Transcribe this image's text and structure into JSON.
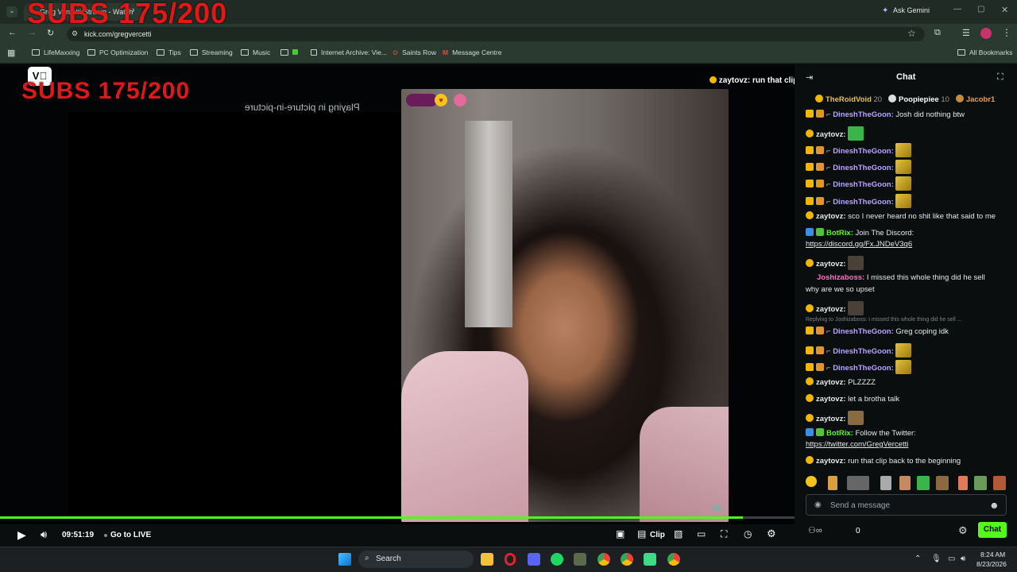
{
  "browser": {
    "tab_title": "Greg Vercetti Stream - Watch",
    "ask_gemini": "Ask Gemini",
    "url": "kick.com/gregvercetti",
    "bookmarks": [
      "LifeMaxxing",
      "PC Optimization",
      "Tips",
      "Streaming",
      "Music",
      "",
      "Internet Archive: Vie...",
      "Saints Row",
      "Message Centre"
    ],
    "all_bookmarks": "All Bookmarks"
  },
  "overlay": {
    "subs_top": "SUBS 175/200",
    "subs_main": "SUBS 175/200",
    "pip_text": "Playing in picture-in-picture",
    "pinned_user": "zaytovz",
    "pinned_text": ": run that clip back to the beginning"
  },
  "player": {
    "time": "09:51:19",
    "go_live": "Go to LIVE",
    "clip": "Clip",
    "progress_percent": 93.5
  },
  "chat": {
    "title": "Chat",
    "leaders": [
      {
        "name": "TheRoidVoid",
        "count": "20"
      },
      {
        "name": "Poopiepiee",
        "count": "10"
      },
      {
        "name": "Jacobr1",
        "count": ""
      }
    ],
    "messages": [
      {
        "user": "DineshTheGoon",
        "text": "Josh did nothing btw",
        "color": "#b9a4ff"
      },
      {
        "user": "zaytovz",
        "text": "",
        "color": "#e6e9ea"
      },
      {
        "user": "DineshTheGoon",
        "text": "",
        "color": "#b9a4ff"
      },
      {
        "user": "DineshTheGoon",
        "text": "",
        "color": "#b9a4ff"
      },
      {
        "user": "DineshTheGoon",
        "text": "",
        "color": "#b9a4ff"
      },
      {
        "user": "DineshTheGoon",
        "text": "",
        "color": "#b9a4ff"
      },
      {
        "user": "zaytovz",
        "text": "sco I never heard no shit like that said to me",
        "color": "#e6e9ea"
      },
      {
        "user": "BotRix",
        "text": "Join The Discord:",
        "link": "https://discord.gg/Fx.JNDeV3q6",
        "color": "#53fc18"
      },
      {
        "user": "zaytovz",
        "text": "",
        "color": "#e6e9ea"
      },
      {
        "user": "Joshizaboss",
        "text": "I missed this whole thing did he sell",
        "text2": "why are we so upset",
        "color": "#ff6ec7"
      },
      {
        "user": "zaytovz",
        "text": "",
        "color": "#e6e9ea"
      },
      {
        "reply": "Replying to Joshizaboss: i missed this whole thing did he sell ..."
      },
      {
        "user": "DineshTheGoon",
        "text": "Greg coping idk",
        "color": "#b9a4ff"
      },
      {
        "user": "DineshTheGoon",
        "text": "",
        "color": "#b9a4ff"
      },
      {
        "user": "DineshTheGoon",
        "text": "",
        "color": "#b9a4ff"
      },
      {
        "user": "zaytovz",
        "text": "PLZZZZ",
        "color": "#e6e9ea"
      },
      {
        "user": "zaytovz",
        "text": "let a brotha talk",
        "color": "#e6e9ea"
      },
      {
        "user": "zaytovz",
        "text": "",
        "color": "#e6e9ea"
      },
      {
        "user": "BotRix",
        "text": "Follow the Twitter:",
        "link": "https://twitter.com/GregVercetti",
        "color": "#53fc18"
      },
      {
        "user": "zaytovz",
        "text": "run that clip back to the beginning",
        "color": "#e6e9ea"
      }
    ],
    "input_placeholder": "Send a message",
    "viewer_count": "0",
    "chat_button": "Chat"
  },
  "taskbar": {
    "search": "Search",
    "time": "8:24 AM",
    "date": "8/23/2026"
  },
  "colors": {
    "accent": "#53fc18",
    "subs_red": "#e11818"
  }
}
